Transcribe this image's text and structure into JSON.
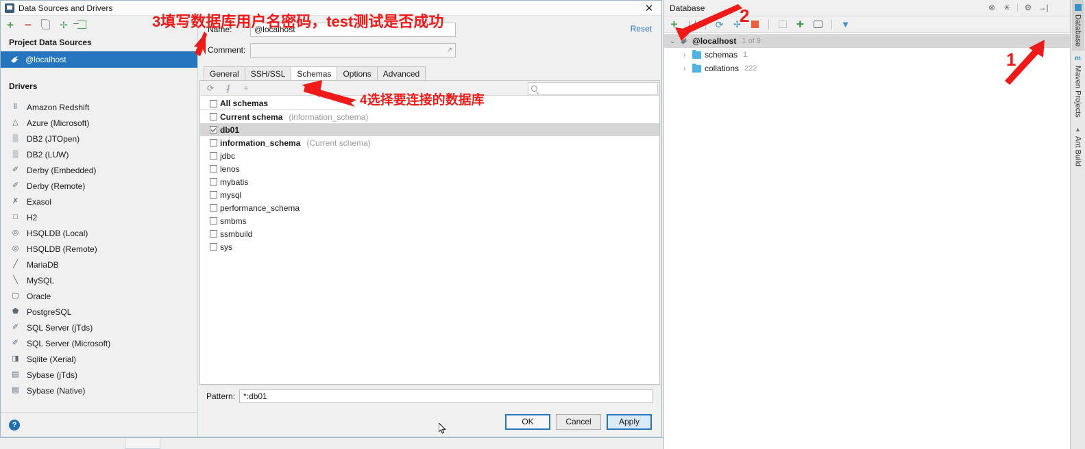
{
  "dialog": {
    "title": "Data Sources and Drivers",
    "close_label": "✕",
    "toolbar": [
      {
        "name": "add-data-source-button",
        "icon": "plus-icon",
        "label": "+"
      },
      {
        "name": "remove-data-source-button",
        "icon": "minus-icon",
        "label": "−"
      },
      {
        "name": "duplicate-data-source-button",
        "icon": "copy-icon",
        "label": ""
      },
      {
        "name": "driver-settings-button",
        "icon": "wrench-icon",
        "label": ""
      },
      {
        "name": "import-data-source-button",
        "icon": "import-icon",
        "label": ""
      }
    ],
    "project_section_label": "Project Data Sources",
    "data_sources": [
      {
        "label": "@localhost",
        "icon": "mysql-dolphin-icon",
        "selected": true
      }
    ],
    "drivers_section_label": "Drivers",
    "drivers": [
      {
        "label": "Amazon Redshift",
        "icon": "redshift-icon",
        "glyph": "‖"
      },
      {
        "label": "Azure (Microsoft)",
        "icon": "azure-icon",
        "glyph": "△"
      },
      {
        "label": "DB2 (JTOpen)",
        "icon": "db2-icon",
        "glyph": "▒"
      },
      {
        "label": "DB2 (LUW)",
        "icon": "db2-icon",
        "glyph": "▒"
      },
      {
        "label": "Derby (Embedded)",
        "icon": "derby-icon",
        "glyph": "✐"
      },
      {
        "label": "Derby (Remote)",
        "icon": "derby-icon",
        "glyph": "✐"
      },
      {
        "label": "Exasol",
        "icon": "exasol-icon",
        "glyph": "✗"
      },
      {
        "label": "H2",
        "icon": "h2-icon",
        "glyph": "□"
      },
      {
        "label": "HSQLDB (Local)",
        "icon": "hsqldb-icon",
        "glyph": "◎"
      },
      {
        "label": "HSQLDB (Remote)",
        "icon": "hsqldb-icon",
        "glyph": "◎"
      },
      {
        "label": "MariaDB",
        "icon": "mariadb-icon",
        "glyph": "╱"
      },
      {
        "label": "MySQL",
        "icon": "mysql-dolphin-icon",
        "glyph": "╲"
      },
      {
        "label": "Oracle",
        "icon": "oracle-icon",
        "glyph": "▢"
      },
      {
        "label": "PostgreSQL",
        "icon": "postgresql-icon",
        "glyph": "⬟"
      },
      {
        "label": "SQL Server (jTds)",
        "icon": "sqlserver-icon",
        "glyph": "✐"
      },
      {
        "label": "SQL Server (Microsoft)",
        "icon": "sqlserver-icon",
        "glyph": "✐"
      },
      {
        "label": "Sqlite (Xerial)",
        "icon": "sqlite-icon",
        "glyph": "◨"
      },
      {
        "label": "Sybase (jTds)",
        "icon": "sybase-icon",
        "glyph": "▤"
      },
      {
        "label": "Sybase (Native)",
        "icon": "sybase-icon",
        "glyph": "▤"
      }
    ],
    "help_label": "?",
    "name_label": "Name:",
    "name_value": "@localhost",
    "comment_label": "Comment:",
    "comment_value": "",
    "reset_label": "Reset",
    "tabs": [
      {
        "label": "General",
        "active": false
      },
      {
        "label": "SSH/SSL",
        "active": false
      },
      {
        "label": "Schemas",
        "active": true
      },
      {
        "label": "Options",
        "active": false
      },
      {
        "label": "Advanced",
        "active": false
      }
    ],
    "panel_toolbar": [
      {
        "name": "refresh-schemas-button",
        "icon": "refresh-icon",
        "glyph": "⟳"
      },
      {
        "name": "expand-all-button",
        "icon": "expand-all-icon",
        "glyph": "⨏"
      },
      {
        "name": "collapse-all-button",
        "icon": "collapse-all-icon",
        "glyph": "÷"
      }
    ],
    "search_placeholder": "",
    "schemas": [
      {
        "label": "All schemas",
        "note": "",
        "checked": false,
        "bold": false,
        "highlight": false,
        "divider": true
      },
      {
        "label": "Current schema",
        "note": "(information_schema)",
        "checked": false,
        "bold": false,
        "highlight": false,
        "divider": false
      },
      {
        "label": "db01",
        "note": "",
        "checked": true,
        "bold": true,
        "highlight": true,
        "divider": false
      },
      {
        "label": "information_schema",
        "note": "(Current schema)",
        "checked": false,
        "bold": true,
        "highlight": false,
        "divider": false
      },
      {
        "label": "jdbc",
        "note": "",
        "checked": false,
        "bold": false,
        "highlight": false,
        "divider": false
      },
      {
        "label": "lenos",
        "note": "",
        "checked": false,
        "bold": false,
        "highlight": false,
        "divider": false
      },
      {
        "label": "mybatis",
        "note": "",
        "checked": false,
        "bold": false,
        "highlight": false,
        "divider": false
      },
      {
        "label": "mysql",
        "note": "",
        "checked": false,
        "bold": false,
        "highlight": false,
        "divider": false
      },
      {
        "label": "performance_schema",
        "note": "",
        "checked": false,
        "bold": false,
        "highlight": false,
        "divider": false
      },
      {
        "label": "smbms",
        "note": "",
        "checked": false,
        "bold": false,
        "highlight": false,
        "divider": false
      },
      {
        "label": "ssmbuild",
        "note": "",
        "checked": false,
        "bold": false,
        "highlight": false,
        "divider": false
      },
      {
        "label": "sys",
        "note": "",
        "checked": false,
        "bold": false,
        "highlight": false,
        "divider": false
      }
    ],
    "pattern_label": "Pattern:",
    "pattern_value": "*:db01",
    "buttons": {
      "ok": "OK",
      "cancel": "Cancel",
      "apply": "Apply"
    }
  },
  "database_panel": {
    "title": "Database",
    "header_icons": [
      {
        "name": "stop-icon",
        "glyph": "⊗"
      },
      {
        "name": "pin-icon",
        "glyph": "✳"
      },
      {
        "name": "settings-gear-icon",
        "glyph": "⚙"
      },
      {
        "name": "collapse-panel-icon",
        "glyph": "→|"
      }
    ],
    "toolbar": [
      {
        "name": "add-button",
        "icon": "plus-icon"
      },
      {
        "name": "delete-button",
        "icon": "trash-icon"
      },
      {
        "name": "refresh-button",
        "icon": "refresh-icon"
      },
      {
        "name": "data-source-properties-button",
        "icon": "wrench-icon"
      },
      {
        "name": "stop-button",
        "icon": "stop-icon"
      },
      {
        "name": "jump-to-table-button",
        "icon": "table-icon"
      },
      {
        "name": "synchronize-button",
        "icon": "sync-icon"
      },
      {
        "name": "open-console-button",
        "icon": "console-icon"
      },
      {
        "name": "filter-button",
        "icon": "filter-icon"
      }
    ],
    "tree": [
      {
        "label": "@localhost",
        "count": "1 of 9",
        "icon": "mysql-dolphin-icon",
        "indent": 0,
        "caret": "⌄",
        "bold": true,
        "selected": true
      },
      {
        "label": "schemas",
        "count": "1",
        "icon": "folder-icon",
        "indent": 1,
        "caret": "›",
        "bold": false,
        "selected": false
      },
      {
        "label": "collations",
        "count": "222",
        "icon": "folder-icon",
        "indent": 1,
        "caret": "›",
        "bold": false,
        "selected": false
      }
    ]
  },
  "vertical_tabs": [
    {
      "label": "Database",
      "icon": "database-icon",
      "active": true
    },
    {
      "label": "Maven Projects",
      "icon": "maven-icon",
      "active": false
    },
    {
      "label": "Ant Build",
      "icon": "ant-icon",
      "active": false
    }
  ],
  "annotations": {
    "step3_text": "3填写数据库用户名密码，test测试是否成功",
    "step4_text": "4选择要连接的数据库",
    "num1": "1",
    "num2": "2",
    "color": "#f01a18"
  }
}
